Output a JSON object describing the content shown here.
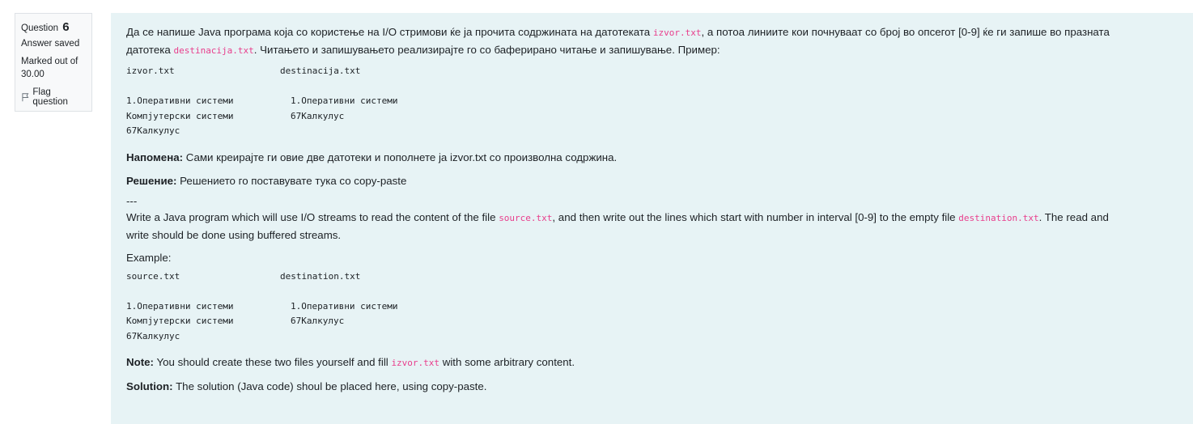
{
  "info": {
    "question_label": "Question",
    "question_number": "6",
    "state": "Answer saved",
    "grade_line1": "Marked out of",
    "grade_line2": "30.00",
    "flag_label": "Flag question"
  },
  "mk": {
    "p1_a": "Да се напише Java програма која со користење на I/O стримови ќе ја прочита содржината на датотеката ",
    "p1_code1": "izvor.txt",
    "p1_b": ", а потоа линиите кои почнуваат со број во опсегот [0-9] ќе ги запише во празната",
    "p1_c": "датотека ",
    "p1_code2": "destinacija.txt",
    "p1_d": ". Читањето и запишувањето реализирајте го со баферирано читање и запишување. Пример:",
    "file_src": "izvor.txt",
    "file_dst": "destinacija.txt",
    "src_lines": [
      "1.Оперативни системи",
      "Компјутерски системи",
      "67Калкулус"
    ],
    "dst_lines": [
      "1.Оперативни системи",
      "67Калкулус"
    ],
    "note_label": "Напомена:",
    "note_text": " Сами креирајте ги овие две датотеки и пополнете ја izvor.txt со произволна содржина.",
    "sol_label": "Решение:",
    "sol_text": " Решението го поставувате тука со copy-paste"
  },
  "separator": "---",
  "en": {
    "p1_a": "Write a Java program which will use I/O streams to read the content of the file ",
    "p1_code1": "source.txt",
    "p1_b": ", and then write out the lines which start with number in interval [0-9] to the empty file ",
    "p1_code2": "destination.txt",
    "p1_c": ". The read and",
    "p1_d": "write should be done using buffered streams.",
    "example_label": "Example:",
    "file_src": "source.txt",
    "file_dst": "destination.txt",
    "src_lines": [
      "1.Оперативни системи",
      "Компјутерски системи",
      "67Калкулус"
    ],
    "dst_lines": [
      "1.Оперативни системи",
      "67Калкулус"
    ],
    "note_label": "Note:",
    "note_a": " You should create these two files yourself and fill ",
    "note_code": "izvor.txt",
    "note_b": " with some arbitrary content.",
    "sol_label": "Solution:",
    "sol_text": " The solution (Java code) shoul be placed here, using copy-paste."
  },
  "colors": {
    "content_bg": "#e7f3f5",
    "info_bg": "#f8f9fa",
    "code_inline": "#e83e8c"
  }
}
